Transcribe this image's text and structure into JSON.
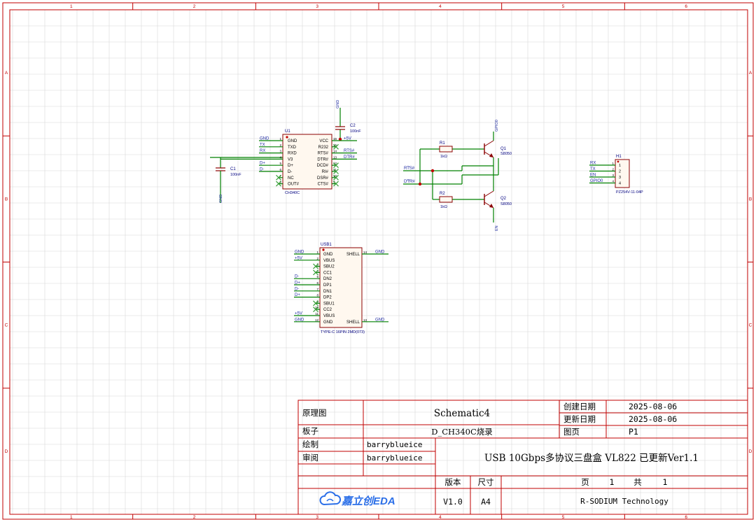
{
  "colors": {
    "background": "#ffffff",
    "frame": "#c00000",
    "grid": "#d8d8d8",
    "symbol": "#8b0000",
    "body_fill": "#fff8ef",
    "wire": "#008000",
    "net_label": "#1e2aa0",
    "pin_text": "#000000",
    "junction": "#c00000",
    "noconnect": "#3aa03a",
    "logo": "#2b6fe8"
  },
  "frame": {
    "columns": [
      "1",
      "2",
      "3",
      "4",
      "5",
      "6"
    ],
    "rows": [
      "A",
      "B",
      "C",
      "D"
    ]
  },
  "u1": {
    "designator": "U1",
    "value": "CH340C",
    "left_pins": [
      {
        "num": "1",
        "name": "GND",
        "net": "GND"
      },
      {
        "num": "2",
        "name": "TXD",
        "net": "TX"
      },
      {
        "num": "3",
        "name": "RXD",
        "net": "RX"
      },
      {
        "num": "4",
        "name": "V3",
        "net": ""
      },
      {
        "num": "5",
        "name": "D+",
        "net": "D+"
      },
      {
        "num": "6",
        "name": "D-",
        "net": "D-"
      },
      {
        "num": "7",
        "name": "NC",
        "net": ""
      },
      {
        "num": "8",
        "name": "OUT#",
        "net": ""
      }
    ],
    "right_pins": [
      {
        "num": "16",
        "name": "VCC",
        "net": "+5V"
      },
      {
        "num": "15",
        "name": "R232",
        "net": ""
      },
      {
        "num": "14",
        "name": "RTS#",
        "net": "RTS#"
      },
      {
        "num": "13",
        "name": "DTR#",
        "net": "DTR#"
      },
      {
        "num": "12",
        "name": "DCD#",
        "net": ""
      },
      {
        "num": "11",
        "name": "RI#",
        "net": ""
      },
      {
        "num": "10",
        "name": "DSR#",
        "net": ""
      },
      {
        "num": "9",
        "name": "CTS#",
        "net": ""
      }
    ]
  },
  "c1": {
    "designator": "C1",
    "value": "100nF",
    "net": "GND"
  },
  "c2": {
    "designator": "C2",
    "value": "100nF",
    "net": "GND"
  },
  "usb1": {
    "designator": "USB1",
    "value": "TYPE-C 16PIN 2MD(073)",
    "left_pins": [
      {
        "num": "1",
        "name": "GND",
        "net": "GND"
      },
      {
        "num": "2",
        "name": "VBUS",
        "net": "+5V"
      },
      {
        "num": "3",
        "name": "SBU2",
        "net": ""
      },
      {
        "num": "4",
        "name": "CC1",
        "net": ""
      },
      {
        "num": "5",
        "name": "DN2",
        "net": "D-"
      },
      {
        "num": "6",
        "name": "DP1",
        "net": "D+"
      },
      {
        "num": "7",
        "name": "DN1",
        "net": "D-"
      },
      {
        "num": "8",
        "name": "DP2",
        "net": "D+"
      },
      {
        "num": "9",
        "name": "SBU1",
        "net": ""
      },
      {
        "num": "10",
        "name": "CC2",
        "net": ""
      },
      {
        "num": "11",
        "name": "VBUS",
        "net": "+5V"
      },
      {
        "num": "12",
        "name": "GND",
        "net": "GND"
      }
    ],
    "right_pins": [
      {
        "num": "14",
        "name": "SHELL",
        "net": "GND"
      },
      {
        "num": "13",
        "name": "SHELL",
        "net": "GND"
      }
    ]
  },
  "r1": {
    "designator": "R1",
    "value": "1kΩ"
  },
  "r2": {
    "designator": "R2",
    "value": "1kΩ"
  },
  "q1": {
    "designator": "Q1",
    "value": "S8050",
    "net_top": "GPIO0"
  },
  "q2": {
    "designator": "Q2",
    "value": "S8050",
    "net_bottom": "EN"
  },
  "rts_label": "RTS#",
  "dtr_label": "DTR#",
  "h1": {
    "designator": "H1",
    "value": "PZ254V-11-04P",
    "pins": [
      {
        "num": "1",
        "net": "RX"
      },
      {
        "num": "2",
        "net": "TX"
      },
      {
        "num": "3",
        "net": "EN"
      },
      {
        "num": "4",
        "net": "GPIO0"
      }
    ]
  },
  "title_block": {
    "label_schematic": "原理图",
    "schematic_name": "Schematic4",
    "label_board": "板子",
    "board_name": "D_CH340C烧录",
    "label_drawn": "绘制",
    "drawn_by": "barryblueice",
    "label_review": "审阅",
    "reviewed_by": "barryblueice",
    "label_created": "创建日期",
    "created": "2025-08-06",
    "label_updated": "更新日期",
    "updated": "2025-08-06",
    "label_page": "图页",
    "page": "P1",
    "project_title": "USB 10Gbps多协议三盘盒 VL822 已更新Ver1.1",
    "label_version": "版本",
    "label_size": "尺寸",
    "version": "V1.0",
    "size": "A4",
    "label_page_word": "页",
    "page_num": "1",
    "label_total": "共",
    "page_total": "1",
    "company": "R-SODIUM Technology",
    "logo_text": "嘉立创EDA"
  }
}
